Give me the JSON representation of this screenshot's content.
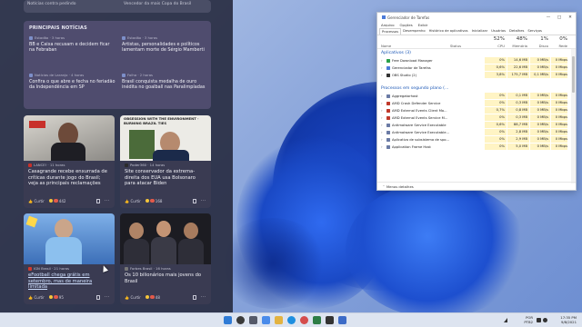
{
  "widgets": {
    "top_strip": {
      "left": "Notícias contra pedindo",
      "right": "Vencedor da mais Copa do Brasil"
    },
    "news": {
      "title": "PRINCIPAIS NOTÍCIAS",
      "items": [
        {
          "source": "Estadão · 3 horas",
          "headline": "BB e Caixa recusam e decidem ficar na Febraban"
        },
        {
          "source": "Estadão · 3 horas",
          "headline": "Artistas, personalidades e políticos lamentam morte de Sérgio Mamberti"
        },
        {
          "source": "Notícias de Laranjo · 4 horas",
          "headline": "Confira o que abre e fecha no feriadão da Independência em SP"
        },
        {
          "source": "Folha · 2 horas",
          "headline": "Brasil conquista medalha de ouro inédita no goalball nas Paralimpíadas"
        }
      ]
    },
    "cards": [
      {
        "source": "LANCE! · 11 horas",
        "headline": "Casagrande recebe enxurrada de críticas durante jogo do Brasil; veja as principais reclamações",
        "like": "Curtir",
        "count": "442",
        "accent": "#c8302a"
      },
      {
        "source": "Poder360 · 14 horas",
        "headline": "Site conservador da extrema-direita dos EUA usa Bolsonaro para atacar Biden",
        "like": "Curtir",
        "count": "168",
        "banner": "OBSESSION WITH THE ENVIRONMENT · BURNING BRAZIL TIES",
        "accent": "#2b2b2b"
      },
      {
        "source": "IGN Brasil · 21 horas",
        "headline": "eFootball chega grátis em setembro, mas de maneira limitada",
        "like": "Curtir",
        "count": "95",
        "accent": "#d23a2f"
      },
      {
        "source": "Forbes Brasil · 16 horas",
        "headline": "Os 10 bilionários mais jovens do Brasil",
        "like": "Curtir",
        "count": "48",
        "accent": "#444444"
      }
    ]
  },
  "taskmgr": {
    "title": "Gerenciador de Tarefas",
    "menu": [
      "Arquivo",
      "Opções",
      "Exibir"
    ],
    "tabs": [
      "Processos",
      "Desempenho",
      "Histórico de aplicativos",
      "Inicializar",
      "Usuários",
      "Detalhes",
      "Serviços"
    ],
    "headers": {
      "name": "Nome",
      "status": "Status",
      "cpu_pct": "52%",
      "cpu": "CPU",
      "mem_pct": "48%",
      "mem": "Memória",
      "disk_pct": "1%",
      "disk": "Disco",
      "net_pct": "0%",
      "net": "Rede"
    },
    "groups": [
      {
        "label": "Aplicativos (3)",
        "rows": [
          {
            "name": "Free Download Manager",
            "cpu": "0%",
            "mem": "14,6 MB",
            "disk": "0 MB/s",
            "net": "0 Mbps",
            "color": "#2aa14a"
          },
          {
            "name": "Gerenciador de Tarefas",
            "cpu": "0,6%",
            "mem": "22,6 MB",
            "disk": "0 MB/s",
            "net": "0 Mbps",
            "color": "#4c7bd8"
          },
          {
            "name": "OBS Studio (2)",
            "cpu": "3,8%",
            "mem": "175,7 MB",
            "disk": "0,1 MB/s",
            "net": "0 Mbps",
            "color": "#333333"
          }
        ]
      },
      {
        "label": "Processos em segundo plano (...",
        "rows": [
          {
            "name": "Aggregatorhost",
            "cpu": "0%",
            "mem": "0,1 MB",
            "disk": "0 MB/s",
            "net": "0 Mbps",
            "color": "#6b7ba5"
          },
          {
            "name": "AMD Crash Defender Service",
            "cpu": "0%",
            "mem": "0,3 MB",
            "disk": "0 MB/s",
            "net": "0 Mbps",
            "color": "#c0392b"
          },
          {
            "name": "AMD External Events Client Mo...",
            "cpu": "0,7%",
            "mem": "0,8 MB",
            "disk": "0 MB/s",
            "net": "0 Mbps",
            "color": "#c0392b"
          },
          {
            "name": "AMD External Events Service M...",
            "cpu": "0%",
            "mem": "0,3 MB",
            "disk": "0 MB/s",
            "net": "0 Mbps",
            "color": "#c0392b"
          },
          {
            "name": "Antimalware Service Executable",
            "cpu": "0,6%",
            "mem": "88,7 MB",
            "disk": "0 MB/s",
            "net": "0 Mbps",
            "color": "#6b7ba5"
          },
          {
            "name": "Antimalware Service Executable...",
            "cpu": "0%",
            "mem": "2,8 MB",
            "disk": "0 MB/s",
            "net": "0 Mbps",
            "color": "#6b7ba5"
          },
          {
            "name": "Aplicativo de subsistema de spo...",
            "cpu": "0%",
            "mem": "2,9 MB",
            "disk": "0 MB/s",
            "net": "0 Mbps",
            "color": "#6b7ba5"
          },
          {
            "name": "Application Frame Host",
            "cpu": "0%",
            "mem": "5,0 MB",
            "disk": "0 MB/s",
            "net": "0 Mbps",
            "color": "#6b7ba5"
          }
        ]
      }
    ],
    "footer": "Menos detalhes"
  },
  "taskbar": {
    "lang": "POR",
    "lang2": "PTB2",
    "time": "17:35 PM",
    "date": "9/8/2021"
  }
}
